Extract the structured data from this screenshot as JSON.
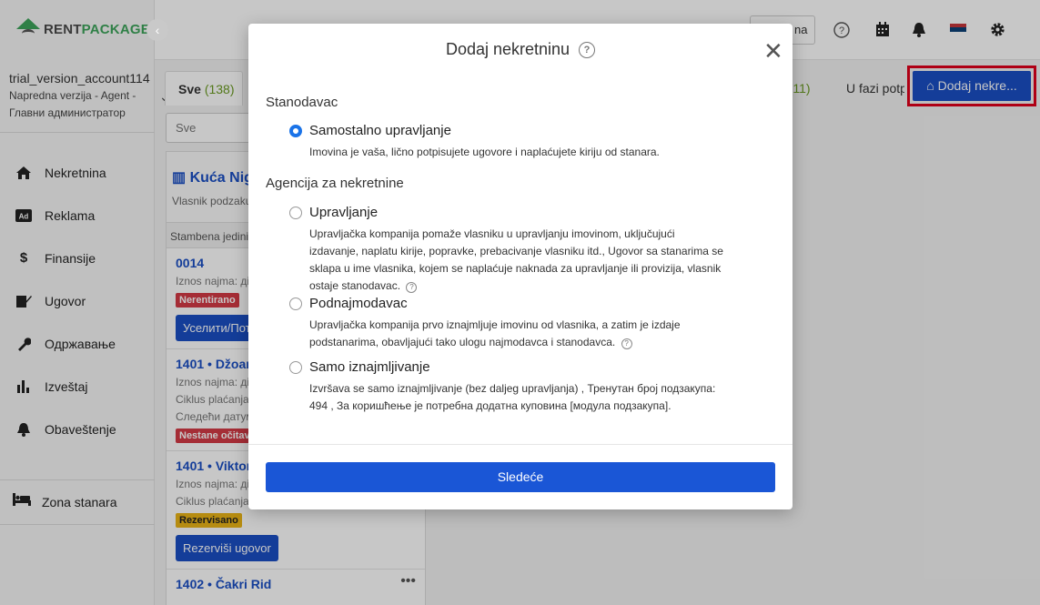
{
  "brand": {
    "rent": "RENT",
    "pkg": "PACKAGE"
  },
  "account": {
    "name": "trial_version_account114",
    "role": "Napredna verzija - Agent - Главни администратор"
  },
  "nav": [
    {
      "label": "Nekretnina",
      "icon": "home-icon"
    },
    {
      "label": "Reklama",
      "icon": "ad-icon"
    },
    {
      "label": "Finansije",
      "icon": "dollar-icon"
    },
    {
      "label": "Ugovor",
      "icon": "contract-icon"
    },
    {
      "label": "Одржавање",
      "icon": "wrench-icon"
    },
    {
      "label": "Izveštaj",
      "icon": "chart-icon"
    },
    {
      "label": "Obaveštenje",
      "icon": "bell-icon"
    }
  ],
  "zona": {
    "label": "Zona stanara",
    "icon": "bed-icon"
  },
  "topbar": {
    "button_fragment": "na"
  },
  "tabs": {
    "all_label": "Sve",
    "all_count": "(138)",
    "b_count": "(11)",
    "b_prefix": "o",
    "c_label": "U fazi potp"
  },
  "add_button": "Dodaj nekre...",
  "search": {
    "placeholder": "Sve"
  },
  "property": {
    "title": "Kuća Nig",
    "subtitle": "Vlasnik podzaku"
  },
  "section_label": "Stambena jedini",
  "units": [
    {
      "title": "0014",
      "lines": [
        "Iznos najma: дi"
      ],
      "badge": "Nerentirano",
      "button": "Уселити/Потп"
    },
    {
      "title": "1401 • Džoan",
      "lines": [
        "Iznos najma: дi",
        "Ciklus plaćanja",
        "Следећи датум"
      ],
      "badge": "Nestane očitava"
    },
    {
      "title": "1401 • Viktor",
      "lines": [
        "Iznos najma: дi",
        "Ciklus plaćanja"
      ],
      "badge": "Rezervisano",
      "button": "Rezerviši ugovor"
    },
    {
      "title": "1402 • Čakri Rid"
    }
  ],
  "modal": {
    "title": "Dodaj nekretninu",
    "section1": "Stanodavac",
    "section2": "Agencija za nekretnine",
    "options": [
      {
        "label": "Samostalno upravljanje",
        "desc": "Imovina je vaša, lično potpisujete ugovore i naplaćujete kiriju od stanara.",
        "selected": true
      },
      {
        "label": "Upravljanje",
        "desc": "Upravljačka kompanija pomaže vlasniku u upravljanju imovinom, uključujući izdavanje, naplatu kirije, popravke, prebacivanje vlasniku itd., Ugovor sa stanarima se sklapa u ime vlasnika, kojem se naplaćuje naknada za upravljanje ili provizija, vlasnik ostaje stanodavac.",
        "selected": false
      },
      {
        "label": "Podnajmodavac",
        "desc": "Upravljačka kompanija prvo iznajmljuje imovinu od vlasnika, a zatim je izdaje podstanarima, obavljajući tako ulogu najmodavca i stanodavca.",
        "selected": false
      },
      {
        "label": "Samo iznajmljivanje",
        "desc": "Izvršava se samo iznajmljivanje (bez daljeg upravljanja) , Тренутан број подзакупа: 494 , За коришћење је потребна додатна куповина [модула подзакупа].",
        "selected": false
      }
    ],
    "next_button": "Sledeće"
  }
}
